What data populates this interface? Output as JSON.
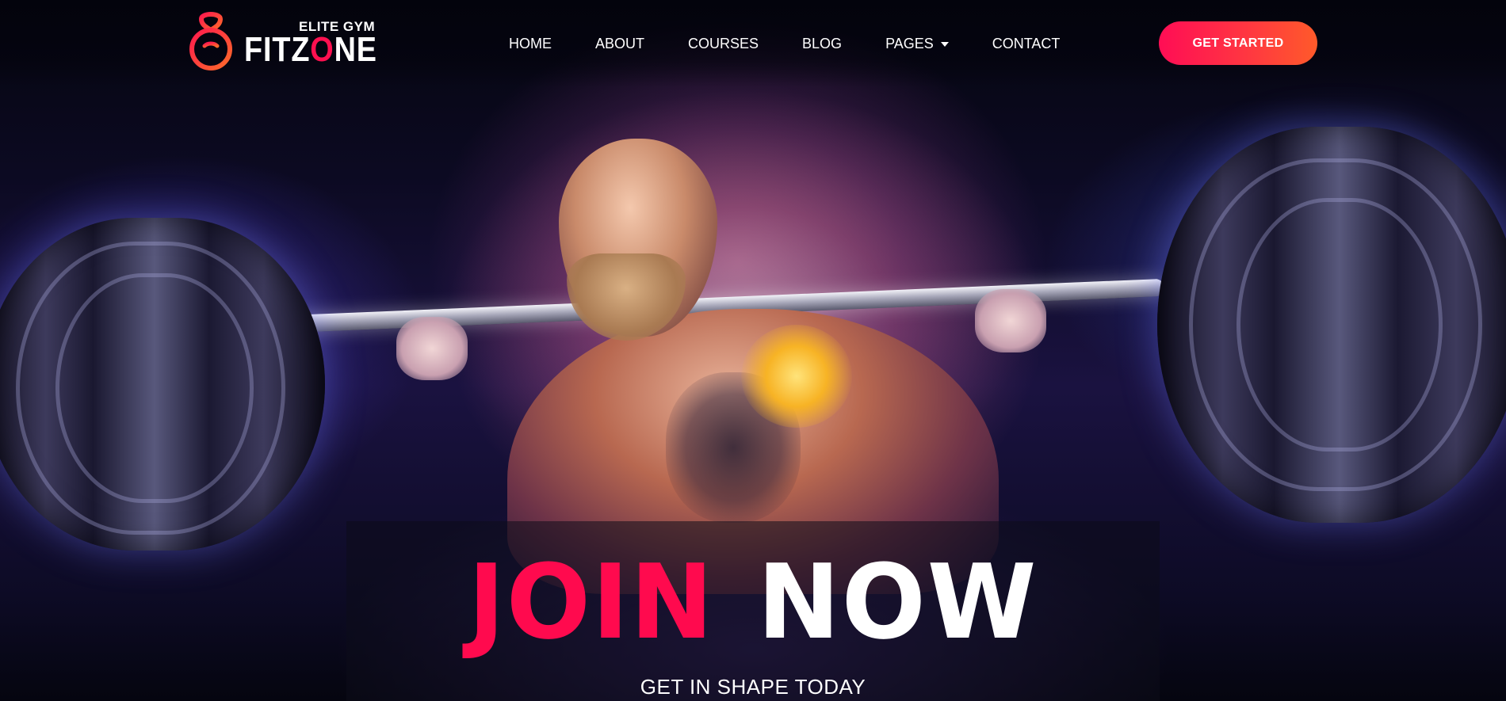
{
  "brand": {
    "tagline": "ELITE GYM",
    "name_part1": "FITZ",
    "name_accent": "O",
    "name_part2": "NE",
    "accent_color": "#ff1050"
  },
  "nav": {
    "items": [
      {
        "label": "HOME"
      },
      {
        "label": "ABOUT"
      },
      {
        "label": "COURSES"
      },
      {
        "label": "BLOG"
      },
      {
        "label": "PAGES",
        "has_dropdown": true
      },
      {
        "label": "CONTACT"
      }
    ]
  },
  "cta": {
    "label": "GET STARTED",
    "gradient_start": "#ff0d55",
    "gradient_end": "#ff5a2a"
  },
  "hero": {
    "title_part1": "JOIN",
    "title_part2": "NOW",
    "subtitle": "GET IN SHAPE TODAY",
    "title_accent_color": "#ff0a4e",
    "background_image": "bodybuilder-barbell-squat-icon"
  }
}
